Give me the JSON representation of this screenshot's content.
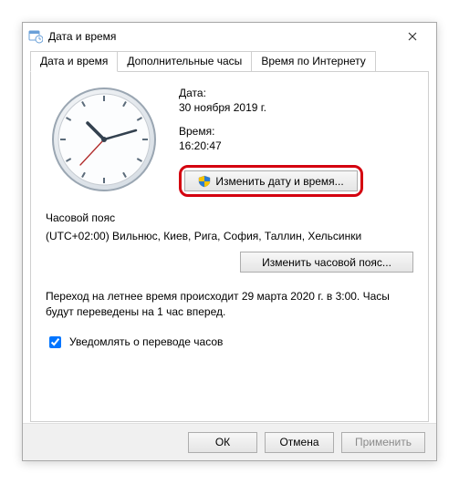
{
  "window": {
    "title": "Дата и время"
  },
  "tabs": [
    {
      "label": "Дата и время"
    },
    {
      "label": "Дополнительные часы"
    },
    {
      "label": "Время по Интернету"
    }
  ],
  "date": {
    "label": "Дата:",
    "value": "30 ноября 2019 г."
  },
  "time": {
    "label": "Время:",
    "value": "16:20:47"
  },
  "buttons": {
    "change_datetime": "Изменить дату и время...",
    "change_tz": "Изменить часовой пояс...",
    "ok": "ОК",
    "cancel": "Отмена",
    "apply": "Применить"
  },
  "tz": {
    "heading": "Часовой пояс",
    "value": "(UTC+02:00) Вильнюс, Киев, Рига, София, Таллин, Хельсинки"
  },
  "dst": {
    "note": "Переход на летнее время происходит 29 марта 2020 г. в 3:00. Часы будут переведены на 1 час вперед.",
    "checkbox_label": "Уведомлять о переводе часов"
  }
}
